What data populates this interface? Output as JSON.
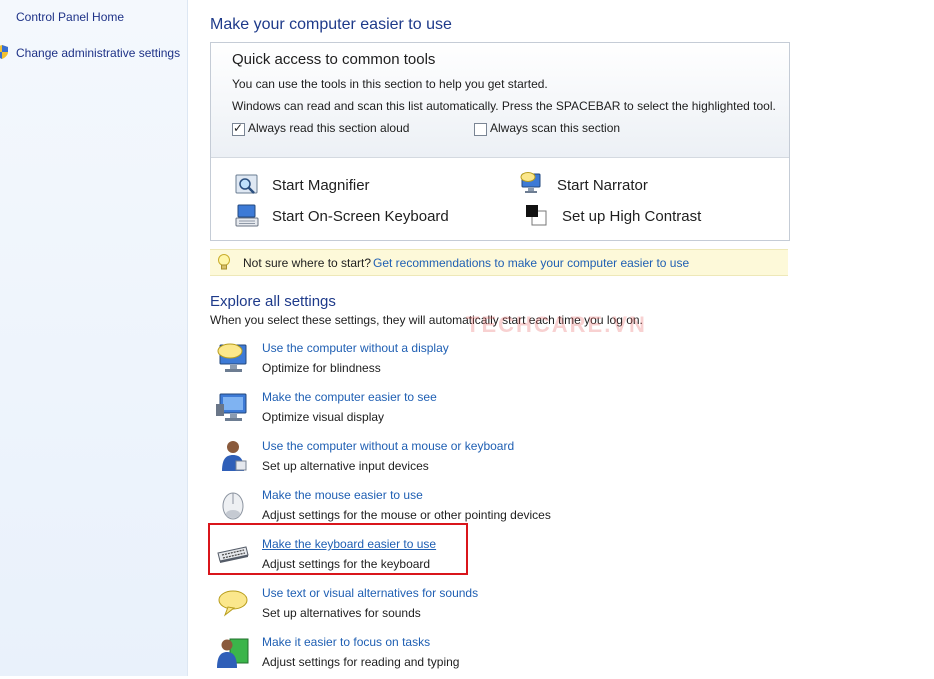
{
  "sidebar": {
    "home_label": "Control Panel Home",
    "admin_label": "Change administrative settings"
  },
  "main": {
    "title": "Make your computer easier to use",
    "quick_access": {
      "heading": "Quick access to common tools",
      "line1": "You can use the tools in this section to help you get started.",
      "line2": "Windows can read and scan this list automatically.  Press the SPACEBAR to select the highlighted tool.",
      "read_aloud_label": "Always read this section aloud",
      "read_aloud_checked": true,
      "scan_label": "Always scan this section",
      "scan_checked": false,
      "tools": [
        {
          "label": "Start Magnifier",
          "icon": "magnifier-icon"
        },
        {
          "label": "Start Narrator",
          "icon": "narrator-icon"
        },
        {
          "label": "Start On-Screen Keyboard",
          "icon": "on-screen-keyboard-icon"
        },
        {
          "label": "Set up High Contrast",
          "icon": "high-contrast-icon"
        }
      ]
    },
    "hint": {
      "text": "Not sure where to start?",
      "link": "Get recommendations to make your computer easier to use",
      "icon": "lightbulb-icon"
    },
    "explore": {
      "title": "Explore all settings",
      "subtitle": "When you select these settings, they will automatically start each time you log on.",
      "watermark": "TECHCARE.VN",
      "items": [
        {
          "link": "Use the computer without a display",
          "desc": "Optimize for blindness",
          "icon": "monitor-speech-icon"
        },
        {
          "link": "Make the computer easier to see",
          "desc": "Optimize visual display",
          "icon": "monitor-icon"
        },
        {
          "link": "Use the computer without a mouse or keyboard",
          "desc": "Set up alternative input devices",
          "icon": "person-icon"
        },
        {
          "link": "Make the mouse easier to use",
          "desc": "Adjust settings for the mouse or other pointing devices",
          "icon": "mouse-icon"
        },
        {
          "link": "Make the keyboard easier to use",
          "desc": "Adjust settings for the keyboard",
          "icon": "keyboard-icon"
        },
        {
          "link": "Use text or visual alternatives for sounds",
          "desc": "Set up alternatives for sounds",
          "icon": "speech-bubble-icon"
        },
        {
          "link": "Make it easier to focus on tasks",
          "desc": "Adjust settings for reading and typing",
          "icon": "focus-person-icon"
        }
      ]
    }
  },
  "colors": {
    "link": "#1f5fb3",
    "title": "#1e3a8a",
    "highlight_box": "#d9151b",
    "hint_background": "#fdf9d9"
  }
}
